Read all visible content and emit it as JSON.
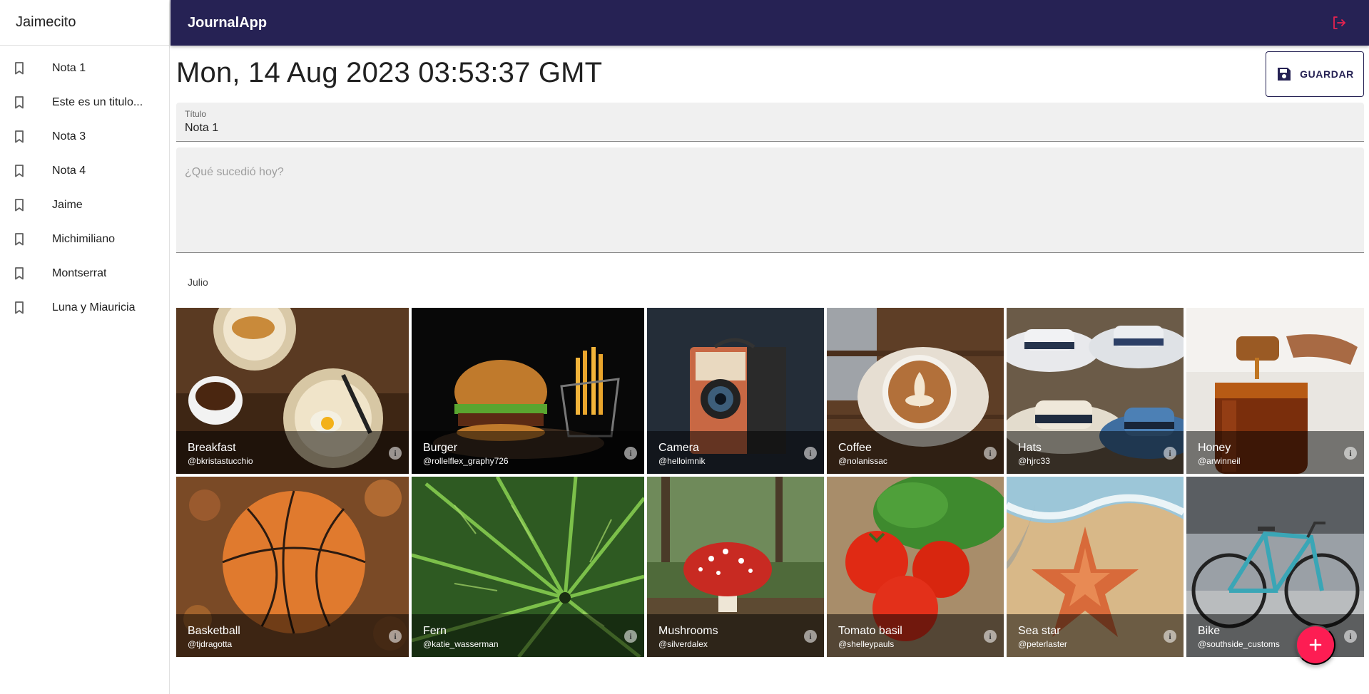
{
  "sidebar": {
    "username": "Jaimecito",
    "items": [
      {
        "label": "Nota 1"
      },
      {
        "label": "Este es un titulo..."
      },
      {
        "label": "Nota 3"
      },
      {
        "label": "Nota 4"
      },
      {
        "label": "Jaime"
      },
      {
        "label": "Michimiliano"
      },
      {
        "label": "Montserrat"
      },
      {
        "label": "Luna y Miauricia"
      }
    ]
  },
  "appbar": {
    "title": "JournalApp",
    "logout_icon": "logout-icon"
  },
  "note": {
    "date": "Mon, 14 Aug 2023 03:53:37 GMT",
    "save_label": "GUARDAR",
    "title_label": "Título",
    "title_value": "Nota 1",
    "body_placeholder": "¿Qué sucedió hoy?",
    "section_label": "Julio"
  },
  "images": [
    {
      "title": "Breakfast",
      "author": "@bkristastucchio"
    },
    {
      "title": "Burger",
      "author": "@rollelflex_graphy726"
    },
    {
      "title": "Camera",
      "author": "@helloimnik"
    },
    {
      "title": "Coffee",
      "author": "@nolanissac"
    },
    {
      "title": "Hats",
      "author": "@hjrc33"
    },
    {
      "title": "Honey",
      "author": "@arwinneil"
    },
    {
      "title": "Basketball",
      "author": "@tjdragotta"
    },
    {
      "title": "Fern",
      "author": "@katie_wasserman"
    },
    {
      "title": "Mushrooms",
      "author": "@silverdalex"
    },
    {
      "title": "Tomato basil",
      "author": "@shelleypauls"
    },
    {
      "title": "Sea star",
      "author": "@peterlaster"
    },
    {
      "title": "Bike",
      "author": "@southside_customs"
    }
  ],
  "colors": {
    "appbar": "#262254",
    "fab": "#fd1d53",
    "logout": "#e8224f"
  }
}
